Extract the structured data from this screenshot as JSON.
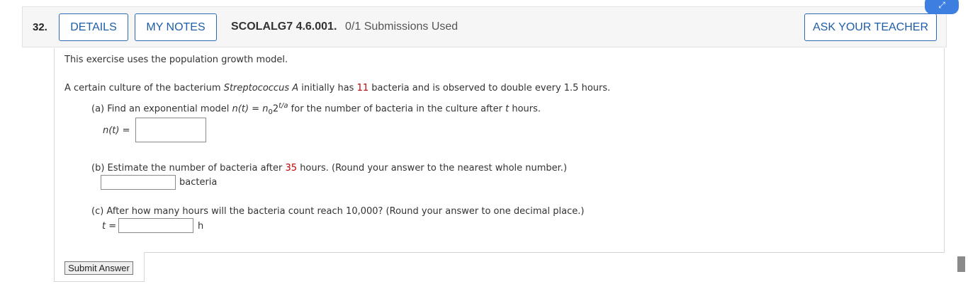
{
  "question": {
    "number": "32.",
    "details_label": "DETAILS",
    "notes_label": "MY NOTES",
    "id": "SCOLALG7 4.6.001.",
    "submissions": "0/1 Submissions Used",
    "ask_label": "ASK YOUR TEACHER"
  },
  "body": {
    "intro": "This exercise uses the population growth model.",
    "problem_pre": "A certain culture of the bacterium",
    "problem_species": "Streptococcus A",
    "problem_mid": "initially has",
    "problem_count": "11",
    "problem_post": "bacteria and is observed to double every 1.5 hours.",
    "part_a_pre": "(a) Find an exponential model",
    "part_a_func": "n(t)",
    "part_a_eq": "=",
    "part_a_n0": "n",
    "part_a_sub": "0",
    "part_a_base": "2",
    "part_a_exp": "t/a",
    "part_a_post": "for the number of bacteria in the culture after",
    "part_a_t": "t",
    "part_a_hours": "hours.",
    "part_a_label": "n(t)",
    "part_a_label_eq": "=",
    "part_b_pre": "(b) Estimate the number of bacteria after",
    "part_b_hours": "35",
    "part_b_post": "hours. (Round your answer to the nearest whole number.)",
    "part_b_unit": "bacteria",
    "part_c_text": "(c) After how many hours will the bacteria count reach 10,000? (Round your answer to one decimal place.)",
    "part_c_label": "t",
    "part_c_eq": "=",
    "part_c_unit": "h"
  },
  "submit_label": "Submit Answer",
  "colors": {
    "accent": "#1f5ea8",
    "highlight": "#c00000"
  }
}
